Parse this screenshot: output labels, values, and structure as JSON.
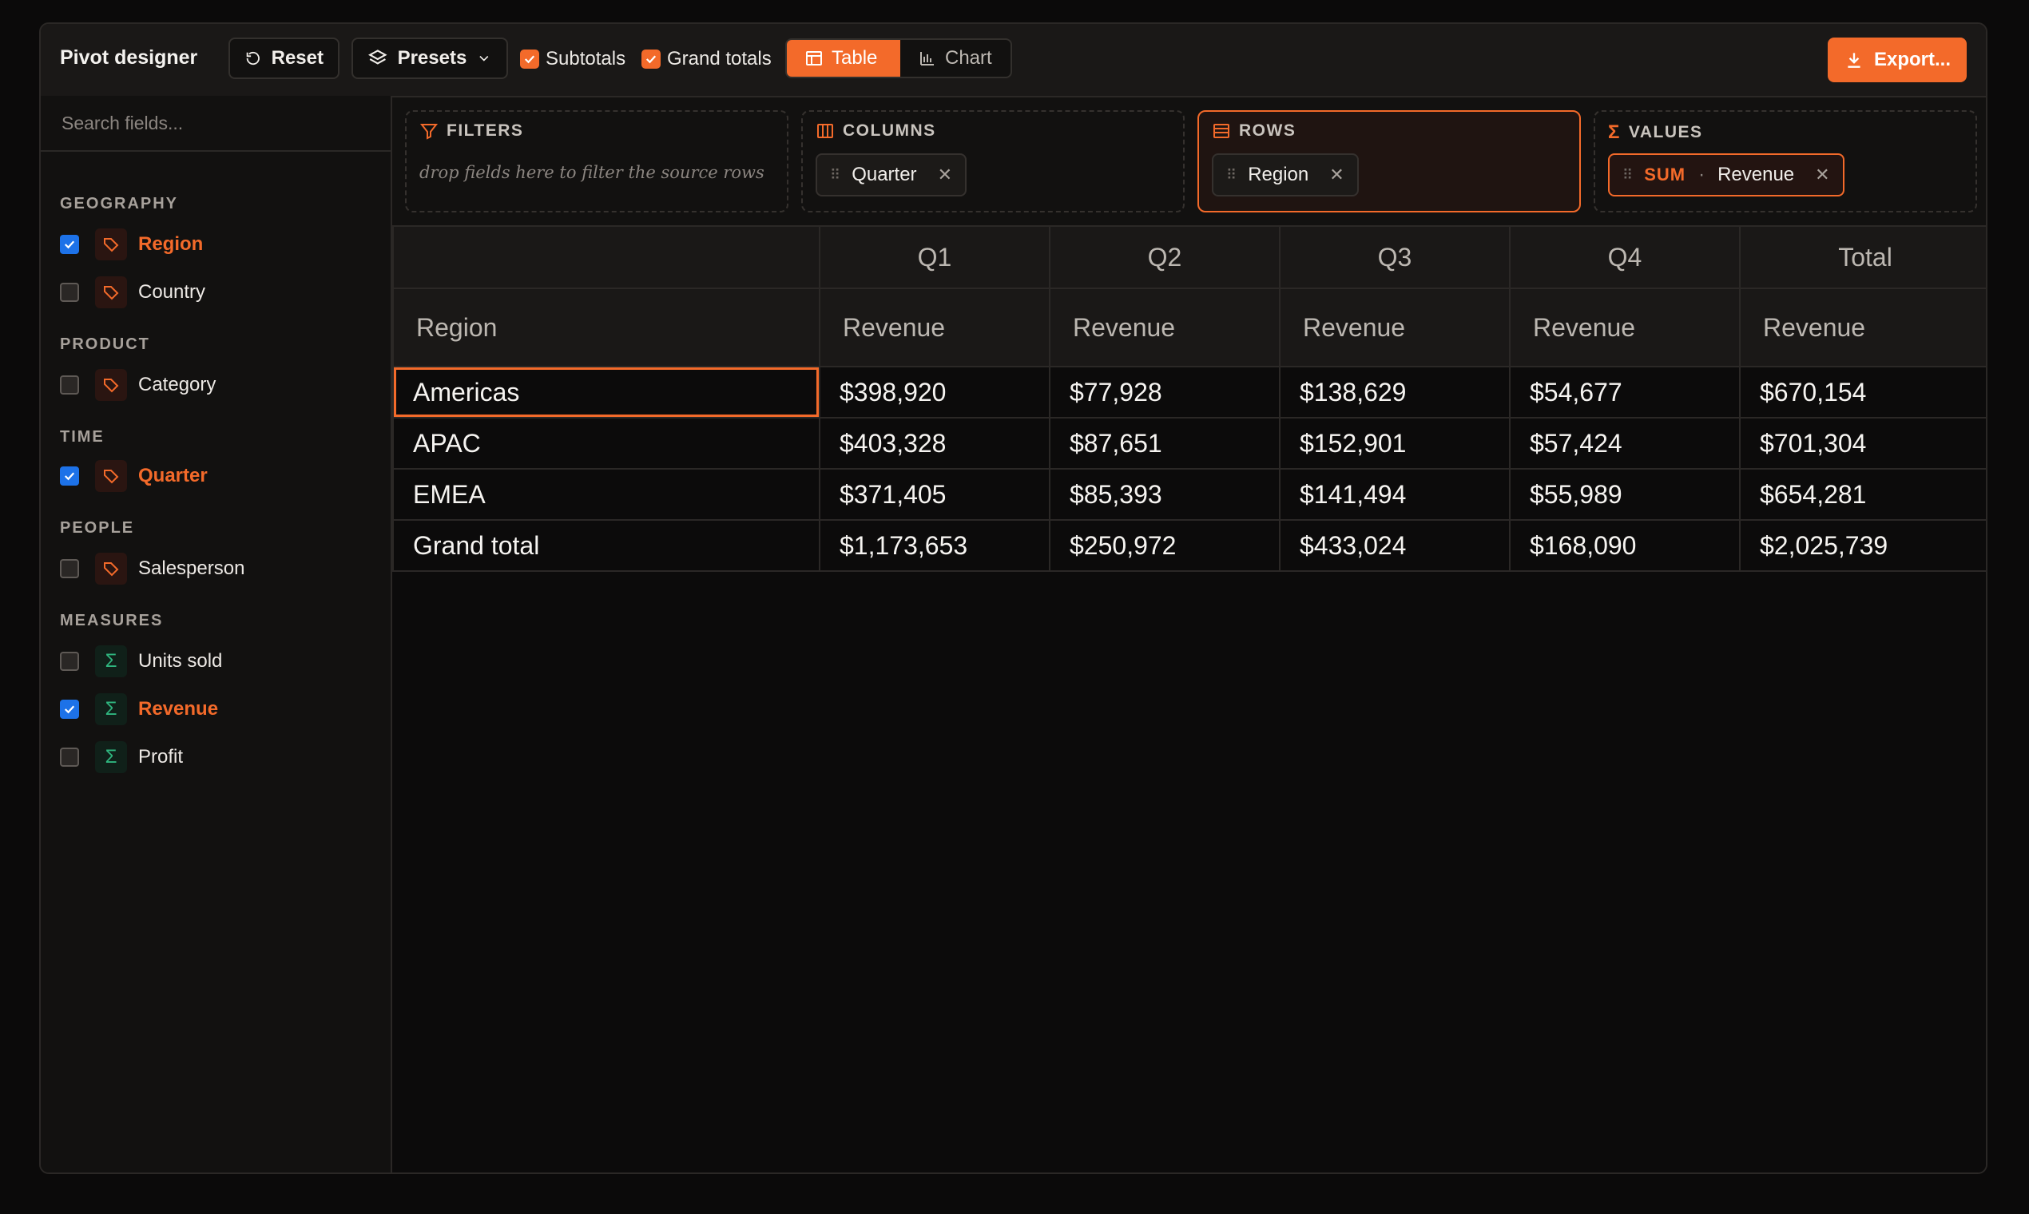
{
  "toolbar": {
    "title": "Pivot designer",
    "reset_label": "Reset",
    "presets_label": "Presets",
    "subtotals_label": "Subtotals",
    "grand_totals_label": "Grand totals",
    "view_table_label": "Table",
    "view_chart_label": "Chart",
    "export_label": "Export...",
    "subtotals_checked": true,
    "grand_totals_checked": true,
    "active_view": "Table"
  },
  "sidebar": {
    "search_placeholder": "Search fields...",
    "groups": [
      {
        "title": "GEOGRAPHY"
      },
      {
        "title": "PRODUCT"
      },
      {
        "title": "TIME"
      },
      {
        "title": "PEOPLE"
      },
      {
        "title": "MEASURES"
      }
    ],
    "fields": [
      {
        "label": "Region",
        "checked": true,
        "kind": "dimension"
      },
      {
        "label": "Country",
        "checked": false,
        "kind": "dimension"
      },
      {
        "label": "Category",
        "checked": false,
        "kind": "dimension"
      },
      {
        "label": "Quarter",
        "checked": true,
        "kind": "dimension"
      },
      {
        "label": "Salesperson",
        "checked": false,
        "kind": "dimension"
      },
      {
        "label": "Units sold",
        "checked": false,
        "kind": "measure"
      },
      {
        "label": "Revenue",
        "checked": true,
        "kind": "measure"
      },
      {
        "label": "Profit",
        "checked": false,
        "kind": "measure"
      }
    ]
  },
  "zones": {
    "filters": {
      "title": "FILTERS",
      "hint": "drop fields here to filter the source rows"
    },
    "columns": {
      "title": "COLUMNS",
      "chip": "Quarter"
    },
    "rows": {
      "title": "ROWS",
      "chip": "Region"
    },
    "values": {
      "title": "VALUES",
      "agg": "SUM",
      "sep": "·",
      "chip": "Revenue"
    }
  },
  "table": {
    "quarters": [
      "Q1",
      "Q2",
      "Q3",
      "Q4",
      "Total"
    ],
    "row_header": "Region",
    "measure": "Revenue",
    "rows": [
      {
        "label": "Americas",
        "values": [
          "$398,920",
          "$77,928",
          "$138,629",
          "$54,677",
          "$670,154"
        ]
      },
      {
        "label": "APAC",
        "values": [
          "$403,328",
          "$87,651",
          "$152,901",
          "$57,424",
          "$701,304"
        ]
      },
      {
        "label": "EMEA",
        "values": [
          "$371,405",
          "$85,393",
          "$141,494",
          "$55,989",
          "$654,281"
        ]
      },
      {
        "label": "Grand total",
        "values": [
          "$1,173,653",
          "$250,972",
          "$433,024",
          "$168,090",
          "$2,025,739"
        ]
      }
    ]
  },
  "colors": {
    "accent": "#f36a2a",
    "checkbox_blue": "#1d72e8",
    "measure_green": "#2fb67f"
  }
}
